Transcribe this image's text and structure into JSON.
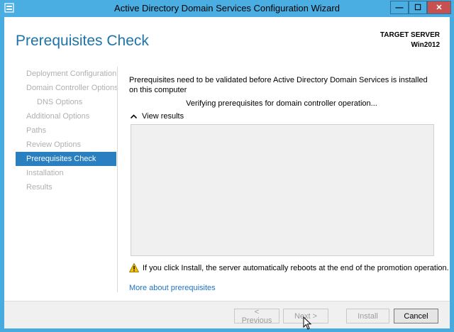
{
  "window": {
    "title": "Active Directory Domain Services Configuration Wizard",
    "controls": {
      "minimize": "—",
      "maximize": "☐",
      "close": "✕"
    }
  },
  "header": {
    "page_title": "Prerequisites Check",
    "target_label": "TARGET SERVER",
    "target_name": "Win2012"
  },
  "nav": {
    "items": [
      {
        "label": "Deployment Configuration"
      },
      {
        "label": "Domain Controller Options"
      },
      {
        "label": "DNS Options"
      },
      {
        "label": "Additional Options"
      },
      {
        "label": "Paths"
      },
      {
        "label": "Review Options"
      },
      {
        "label": "Prerequisites Check"
      },
      {
        "label": "Installation"
      },
      {
        "label": "Results"
      }
    ]
  },
  "main": {
    "description": "Prerequisites need to be validated before Active Directory Domain Services is installed on this computer",
    "verifying": "Verifying prerequisites for domain controller operation...",
    "view_results": "View results",
    "warning": "If you click Install, the server automatically reboots at the end of the promotion operation.",
    "more_link": "More about prerequisites"
  },
  "footer": {
    "previous": "< Previous",
    "next": "Next >",
    "install": "Install",
    "cancel": "Cancel"
  },
  "colors": {
    "accent": "#2a7fc0",
    "titlebar": "#4aaee3",
    "close": "#c75050",
    "link": "#1e73c6"
  }
}
